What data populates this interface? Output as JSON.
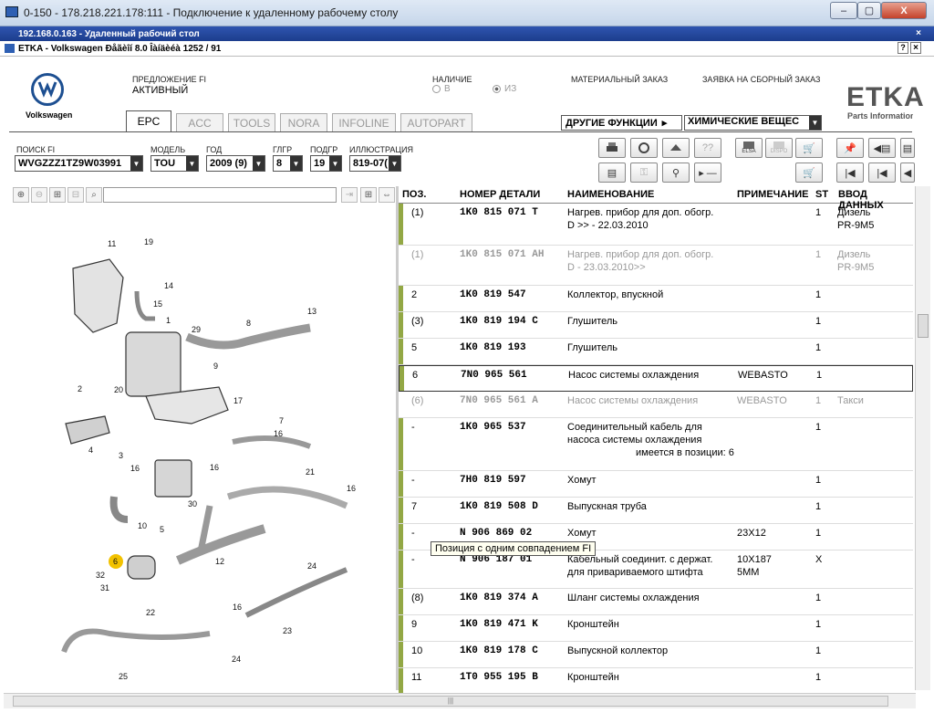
{
  "window": {
    "title": "0-150 - 178.218.221.178:111 - Подключение к удаленному рабочему столу",
    "rdp_host": "192.168.0.163 - Удаленный рабочий стол",
    "etka_title": "ETKA - Volkswagen Ðåãèîí 8.0 Îàíäèéà 1252 / 91",
    "min": "–",
    "max": "▢",
    "close": "X",
    "inner_help": "?",
    "inner_close": "×"
  },
  "brand": {
    "name": "Volkswagen",
    "logo_text": "ETKA",
    "logo_sub": "Parts Information"
  },
  "proposal": {
    "label": "ПРЕДЛОЖЕНИЕ FI",
    "value": "АКТИВНЫЙ"
  },
  "availability": {
    "label": "НАЛИЧИЕ",
    "opt1": "В",
    "opt2": "ИЗ",
    "selected": "ИЗ"
  },
  "links": {
    "material_order": "МАТЕРИАЛЬНЫЙ ЗАКАЗ",
    "assembly_order": "ЗАЯВКА НА СБОРНЫЙ ЗАКАЗ"
  },
  "tabs": [
    "EPC",
    "ACC",
    "TOOLS",
    "NORA",
    "INFOLINE",
    "AUTOPART"
  ],
  "active_tab": "EPC",
  "other_functions": {
    "label": "ДРУГИЕ ФУНКЦИИ",
    "arrow": "▸",
    "value": "ХИМИЧЕСКИЕ ВЕЩЕС"
  },
  "filters": [
    {
      "label": "ПОИСК FI",
      "value": "WVGZZZ1TZ9W03991"
    },
    {
      "label": "МОДЕЛЬ",
      "value": "TOU"
    },
    {
      "label": "ГОД",
      "value": "2009 (9)"
    },
    {
      "label": "ГЛГР",
      "value": "8"
    },
    {
      "label": "ПОДГР",
      "value": "19"
    },
    {
      "label": "ИЛЛЮСТРАЦИЯ",
      "value": "819-07("
    }
  ],
  "toolbar_icons": {
    "row1": [
      "printer-icon",
      "wrench-icon",
      "lock-icon",
      "help-icon",
      "elsa-icon",
      "dispo-icon",
      "cart-add-icon",
      "pin-icon",
      "back-icon",
      "document-icon"
    ],
    "row1_text": {
      "elsa": "ELSA",
      "dispo": "DISPO"
    },
    "row2": [
      "list-icon",
      "key-icon",
      "bike-icon",
      "next-minus-icon",
      "cart-icon",
      "first-icon",
      "prev-icon",
      "prev2-icon"
    ]
  },
  "grid": {
    "headers": [
      "ПОЗ.",
      "НОМЕР ДЕТАЛИ",
      "НАИМЕНОВАНИЕ",
      "ПРИМЕЧАНИЕ",
      "ST",
      "ВВОД ДАННЫХ"
    ],
    "rows": [
      {
        "pos": "(1)",
        "part": "1K0  815  071  T",
        "name1": "Нагрев. прибор для доп. обогр.",
        "name2": "D               >> - 22.03.2010",
        "note": "",
        "st": "1",
        "data1": "Дизель",
        "data2": "PR-9M5",
        "gray": false
      },
      {
        "pos": "(1)",
        "part": "1K0  815  071  AH",
        "name1": "Нагрев. прибор для доп. обогр.",
        "name2": "D - 23.03.2010>>",
        "note": "",
        "st": "1",
        "data1": "Дизель",
        "data2": "PR-9M5",
        "gray": true
      },
      {
        "pos": "2",
        "part": "1K0  819  547",
        "name1": "Коллектор, впускной",
        "name2": "",
        "note": "",
        "st": "1",
        "data1": "",
        "data2": "",
        "gray": false
      },
      {
        "pos": "(3)",
        "part": "1K0  819  194  C",
        "name1": "Глушитель",
        "name2": "",
        "note": "",
        "st": "1",
        "data1": "",
        "data2": "",
        "gray": false
      },
      {
        "pos": "5",
        "part": "1K0  819  193",
        "name1": "Глушитель",
        "name2": "",
        "note": "",
        "st": "1",
        "data1": "",
        "data2": "",
        "gray": false
      },
      {
        "pos": "6",
        "part": "7N0  965  561",
        "name1": "Насос системы охлаждения",
        "name2": "",
        "note": "WEBASTO",
        "st": "1",
        "data1": "",
        "data2": "",
        "gray": false
      },
      {
        "pos": "(6)",
        "part": "7N0  965  561  A",
        "name1": "Насос системы охлаждения",
        "name2": "",
        "note": "WEBASTO",
        "st": "1",
        "data1": "Такси",
        "data2": "",
        "gray": true
      },
      {
        "pos": "-",
        "part": "1K0  965  537",
        "name1": "Соединительный кабель для",
        "name2": "насоса системы охлаждения",
        "name3": "имеется в позиции:  6",
        "note": "",
        "st": "1",
        "data1": "",
        "data2": "",
        "gray": false
      },
      {
        "pos": "-",
        "part": "7H0  819  597",
        "name1": "Хомут",
        "name2": "",
        "note": "",
        "st": "1",
        "data1": "",
        "data2": "",
        "gray": false
      },
      {
        "pos": "7",
        "part": "1K0  819  508  D",
        "name1": "Выпускная труба",
        "name2": "",
        "note": "",
        "st": "1",
        "data1": "",
        "data2": "",
        "gray": false
      },
      {
        "pos": "-",
        "part": "N    906  869  02",
        "name1": "Хомут",
        "name2": "",
        "note": "23X12",
        "st": "1",
        "data1": "",
        "data2": "",
        "gray": false
      },
      {
        "pos": "-",
        "part": "N    906  187  01",
        "name1": "Кабельный соединит. с держат.",
        "name2": "для привариваемого штифта",
        "note": "10X187",
        "note2": "5MM",
        "st": "X",
        "data1": "",
        "data2": "",
        "gray": false
      },
      {
        "pos": "(8)",
        "part": "1K0  819  374  A",
        "name1": "Шланг системы охлаждения",
        "name2": "",
        "note": "",
        "st": "1",
        "data1": "",
        "data2": "",
        "gray": false
      },
      {
        "pos": "9",
        "part": "1K0  819  471  K",
        "name1": "Кронштейн",
        "name2": "",
        "note": "",
        "st": "1",
        "data1": "",
        "data2": "",
        "gray": false
      },
      {
        "pos": "10",
        "part": "1K0  819  178  C",
        "name1": "Выпускной коллектор",
        "name2": "",
        "note": "",
        "st": "1",
        "data1": "",
        "data2": "",
        "gray": false
      },
      {
        "pos": "11",
        "part": "1T0  955  195  B",
        "name1": "Кронштейн",
        "name2": "",
        "note": "",
        "st": "1",
        "data1": "",
        "data2": "",
        "gray": false
      }
    ]
  },
  "tooltip": "Позиция с одним совпадением FI",
  "diagram_labels": [
    "11",
    "19",
    "14",
    "15",
    "1",
    "29",
    "8",
    "13",
    "9",
    "2",
    "20",
    "17",
    "4",
    "3",
    "7",
    "16",
    "16",
    "16",
    "21",
    "16",
    "10",
    "5",
    "30",
    "12",
    "6",
    "32",
    "31",
    "24",
    "16",
    "22",
    "23",
    "24",
    "25"
  ],
  "scroll_grip": "|||"
}
